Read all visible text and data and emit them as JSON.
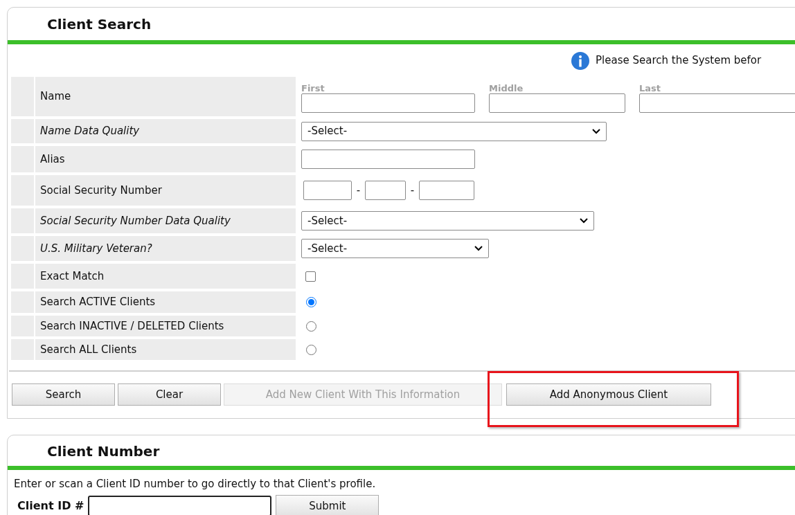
{
  "search_panel": {
    "title": "Client Search",
    "notice": "Please Search the System befor",
    "rows": [
      {
        "kind": "name",
        "label": "Name",
        "italic": false,
        "parts": [
          "First",
          "Middle",
          "Last"
        ]
      },
      {
        "kind": "select",
        "label": "Name Data Quality",
        "italic": true,
        "value": "-Select-"
      },
      {
        "kind": "text",
        "label": "Alias",
        "italic": false
      },
      {
        "kind": "ssn",
        "label": "Social Security Number",
        "italic": false,
        "separators": [
          "-",
          "-"
        ]
      },
      {
        "kind": "select",
        "label": "Social Security Number Data Quality",
        "italic": true,
        "value": "-Select-"
      },
      {
        "kind": "select",
        "label": "U.S. Military Veteran?",
        "italic": true,
        "value": "-Select-"
      },
      {
        "kind": "checkbox",
        "label": "Exact Match",
        "italic": false,
        "checked": false
      },
      {
        "kind": "radio",
        "label": "Search ACTIVE Clients",
        "italic": false,
        "selected": true
      },
      {
        "kind": "radio",
        "label": "Search INACTIVE / DELETED Clients",
        "italic": false,
        "selected": false
      },
      {
        "kind": "radio",
        "label": "Search ALL Clients",
        "italic": false,
        "selected": false
      }
    ],
    "buttons": [
      {
        "label": "Search",
        "disabled": false,
        "highlighted": false
      },
      {
        "label": "Clear",
        "disabled": false,
        "highlighted": false
      },
      {
        "label": "Add New Client With This Information",
        "disabled": true,
        "highlighted": false
      },
      {
        "label": "Add Anonymous Client",
        "disabled": false,
        "highlighted": true
      }
    ]
  },
  "number_panel": {
    "title": "Client Number",
    "instructions": "Enter or scan a Client ID number to go directly to that Client's profile.",
    "field_label": "Client ID #",
    "button": "Submit"
  }
}
